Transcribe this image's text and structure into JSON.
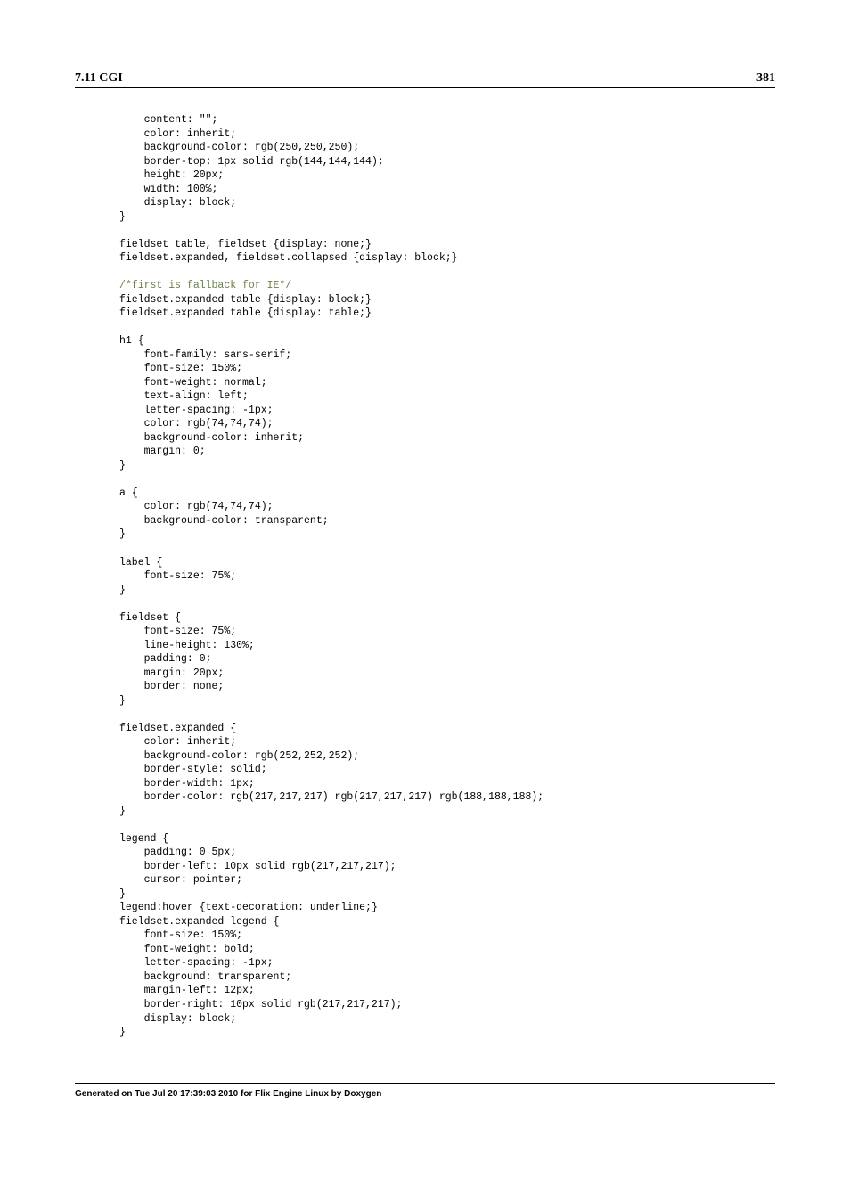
{
  "header": {
    "section": "7.11 CGI",
    "page_number": "381"
  },
  "footer": {
    "generated": "Generated on Tue Jul 20 17:39:03 2010 for Flix Engine Linux by Doxygen"
  },
  "code": {
    "l01": "    content: \"\";",
    "l02": "    color: inherit;",
    "l03": "    background-color: rgb(250,250,250);",
    "l04": "    border-top: 1px solid rgb(144,144,144);",
    "l05": "    height: 20px;",
    "l06": "    width: 100%;",
    "l07": "    display: block;",
    "l08": "}",
    "l09": "",
    "l10": "fieldset table, fieldset {display: none;}",
    "l11": "fieldset.expanded, fieldset.collapsed {display: block;}",
    "l12": "",
    "l13": "/*first is fallback for IE*/",
    "l14": "fieldset.expanded table {display: block;}",
    "l15": "fieldset.expanded table {display: table;}",
    "l16": "",
    "l17": "h1 {",
    "l18": "    font-family: sans-serif;",
    "l19": "    font-size: 150%;",
    "l20": "    font-weight: normal;",
    "l21": "    text-align: left;",
    "l22": "    letter-spacing: -1px;",
    "l23": "    color: rgb(74,74,74);",
    "l24": "    background-color: inherit;",
    "l25": "    margin: 0;",
    "l26": "}",
    "l27": "",
    "l28": "a {",
    "l29": "    color: rgb(74,74,74);",
    "l30": "    background-color: transparent;",
    "l31": "}",
    "l32": "",
    "l33": "label {",
    "l34": "    font-size: 75%;",
    "l35": "}",
    "l36": "",
    "l37": "fieldset {",
    "l38": "    font-size: 75%;",
    "l39": "    line-height: 130%;",
    "l40": "    padding: 0;",
    "l41": "    margin: 20px;",
    "l42": "    border: none;",
    "l43": "}",
    "l44": "",
    "l45": "fieldset.expanded {",
    "l46": "    color: inherit;",
    "l47": "    background-color: rgb(252,252,252);",
    "l48": "    border-style: solid;",
    "l49": "    border-width: 1px;",
    "l50": "    border-color: rgb(217,217,217) rgb(217,217,217) rgb(188,188,188);",
    "l51": "}",
    "l52": "",
    "l53": "legend {",
    "l54": "    padding: 0 5px;",
    "l55": "    border-left: 10px solid rgb(217,217,217);",
    "l56": "    cursor: pointer;",
    "l57": "}",
    "l58": "legend:hover {text-decoration: underline;}",
    "l59": "fieldset.expanded legend {",
    "l60": "    font-size: 150%;",
    "l61": "    font-weight: bold;",
    "l62": "    letter-spacing: -1px;",
    "l63": "    background: transparent;",
    "l64": "    margin-left: 12px;",
    "l65": "    border-right: 10px solid rgb(217,217,217);",
    "l66": "    display: block;",
    "l67": "}"
  }
}
